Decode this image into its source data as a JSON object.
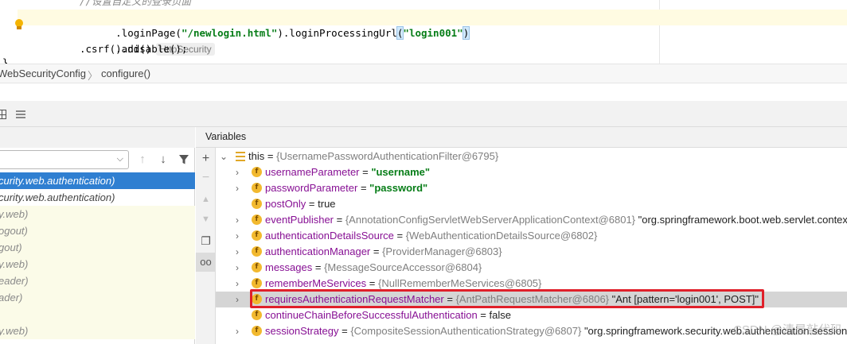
{
  "editor": {
    "lines": [
      {
        "comment": "//设置自定义的登录页面"
      },
      {
        "parts": [
          ".loginPage(",
          "\"/newlogin.html\"",
          ").loginProcessingUrl",
          "(",
          "\"login001\"",
          ")"
        ]
      },
      {
        "code": ".and()",
        "hint": "HttpSecurity"
      },
      {
        "code": ".csrf().disable();"
      }
    ],
    "closing_brace": "}"
  },
  "breadcrumb": {
    "class_name": "WebSecurityConfig",
    "separator": "〉",
    "method_name": "configure()"
  },
  "variables_panel": {
    "title": "Variables",
    "rows": [
      {
        "name": "this",
        "eq": " = ",
        "type": "{UsernamePasswordAuthenticationFilter@6795}",
        "value": ""
      },
      {
        "name": "usernameParameter",
        "eq": " = ",
        "type": "",
        "value": "\"username\"",
        "value_kind": "string"
      },
      {
        "name": "passwordParameter",
        "eq": " = ",
        "type": "",
        "value": "\"password\"",
        "value_kind": "string"
      },
      {
        "name": "postOnly",
        "eq": " = ",
        "type": "",
        "value": "true",
        "value_kind": "plain"
      },
      {
        "name": "eventPublisher",
        "eq": " = ",
        "type": "{AnnotationConfigServletWebServerApplicationContext@6801}",
        "value": " \"org.springframework.boot.web.servlet.contex",
        "value_kind": "plain"
      },
      {
        "name": "authenticationDetailsSource",
        "eq": " = ",
        "type": "{WebAuthenticationDetailsSource@6802}",
        "value": ""
      },
      {
        "name": "authenticationManager",
        "eq": " = ",
        "type": "{ProviderManager@6803}",
        "value": ""
      },
      {
        "name": "messages",
        "eq": " = ",
        "type": "{MessageSourceAccessor@6804}",
        "value": ""
      },
      {
        "name": "rememberMeServices",
        "eq": " = ",
        "type": "{NullRememberMeServices@6805}",
        "value": ""
      },
      {
        "name": "requiresAuthenticationRequestMatcher",
        "eq": " = ",
        "type": "{AntPathRequestMatcher@6806}",
        "value": " \"Ant [pattern='login001', POST]\"",
        "value_kind": "plain"
      },
      {
        "name": "continueChainBeforeSuccessfulAuthentication",
        "eq": " = ",
        "type": "",
        "value": "false",
        "value_kind": "plain"
      },
      {
        "name": "sessionStrategy",
        "eq": " = ",
        "type": "{CompositeSessionAuthenticationStrategy@6807}",
        "value": " \"org.springframework.security.web.authentication.session.",
        "value_kind": "plain"
      }
    ]
  },
  "frames_panel": {
    "frames": [
      {
        "text": "curity.web.authentication)",
        "state": "selected"
      },
      {
        "text": "curity.web.authentication)",
        "state": "normal"
      },
      {
        "text": "y.web)",
        "state": "lib"
      },
      {
        "text": "ogout)",
        "state": "lib"
      },
      {
        "text": "gout)",
        "state": "lib"
      },
      {
        "text": "y.web)",
        "state": "lib"
      },
      {
        "text": "eader)",
        "state": "lib"
      },
      {
        "text": "ader)",
        "state": "lib"
      },
      {
        "text": "",
        "state": "lib"
      },
      {
        "text": "y.web)",
        "state": "lib"
      }
    ]
  },
  "watermark": "CSDN @清晨敲代码",
  "colors": {
    "selected_frame": "#2f7fd1",
    "highlight_box": "#e0202a",
    "string_value": "#067d17",
    "field_name": "#871094"
  }
}
